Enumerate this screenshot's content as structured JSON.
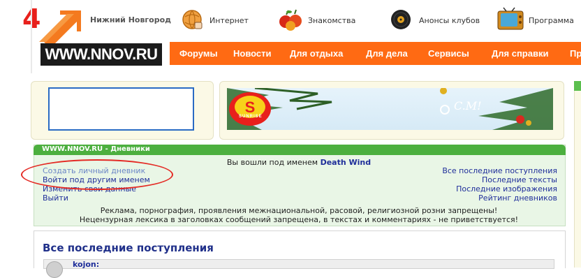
{
  "header": {
    "logo_number": "4",
    "logo_url": "WWW.NNOV.RU",
    "city": "Нижний Новгород",
    "top_links": [
      {
        "label": "Интернет",
        "icon": "globe-hand-icon"
      },
      {
        "label": "Знакомства",
        "icon": "apples-icon"
      },
      {
        "label": "Анонсы клубов",
        "icon": "vinyl-record-icon"
      },
      {
        "label": "Программа",
        "icon": "tv-icon"
      }
    ],
    "nav": [
      "Форумы",
      "Новости",
      "Для отдыха",
      "Для дела",
      "Сервисы",
      "Для справки",
      "Пр"
    ]
  },
  "banner": {
    "logo_text": "SUNRISE",
    "greeting": "C.M!"
  },
  "panel": {
    "title": "WWW.NNOV.RU - Дневники",
    "login_prefix": "Вы вошли под именем",
    "login_user": "Death Wind",
    "left_links": [
      "Создать личный дневник",
      "Войти под другим именем",
      "Изменить свои данные",
      "Выйти"
    ],
    "right_links": [
      "Все последние поступления",
      "Последние тексты",
      "Последние изображения",
      "Рейтинг дневников"
    ],
    "rules": [
      "Реклама, порнография, проявления межнациональной, расовой, религиозной розни запрещены!",
      "Нецензурная лексика в заголовках сообщений запрещена, в текстах и комментариях - не приветствуется!"
    ]
  },
  "recent": {
    "title": "Все последние поступления",
    "first_entry_user": "kojon:"
  },
  "colors": {
    "nav_orange": "#ff6a13",
    "panel_green": "#4caf3f",
    "panel_bg": "#e9f6e6",
    "link_blue": "#1f2e9a",
    "highlight_red": "#e42a24"
  }
}
